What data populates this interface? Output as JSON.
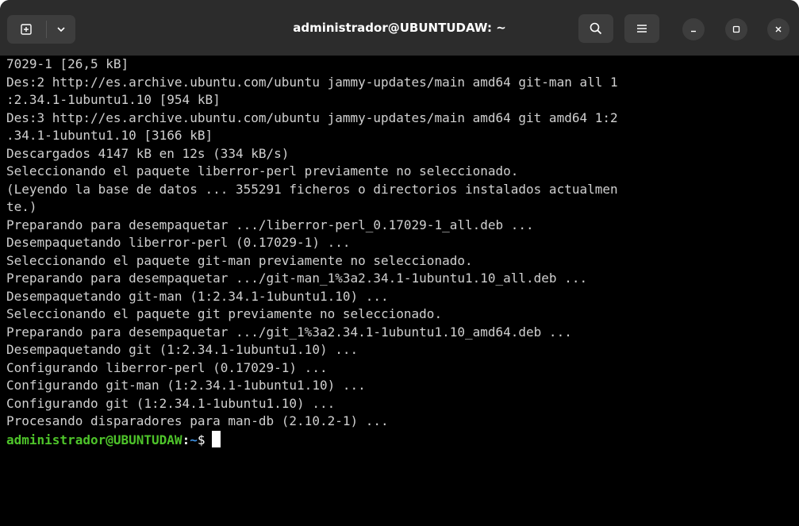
{
  "window": {
    "title": "administrador@UBUNTUDAW: ~",
    "colors": {
      "titlebar": "#2c2c2c",
      "button": "#3d3d3d",
      "terminal_bg": "#000000",
      "text": "#d0d0d0",
      "prompt_user": "#4ec42a",
      "prompt_path": "#3d8fe0"
    }
  },
  "header": {
    "new_tab_icon": "new-tab-icon",
    "dropdown_icon": "chevron-down-icon",
    "search_icon": "search-icon",
    "menu_icon": "hamburger-menu-icon",
    "minimize_icon": "minimize-icon",
    "maximize_icon": "maximize-icon",
    "close_icon": "close-icon"
  },
  "terminal": {
    "lines": [
      "7029-1 [26,5 kB]",
      "Des:2 http://es.archive.ubuntu.com/ubuntu jammy-updates/main amd64 git-man all 1",
      ":2.34.1-1ubuntu1.10 [954 kB]",
      "Des:3 http://es.archive.ubuntu.com/ubuntu jammy-updates/main amd64 git amd64 1:2",
      ".34.1-1ubuntu1.10 [3166 kB]",
      "Descargados 4147 kB en 12s (334 kB/s)",
      "Seleccionando el paquete liberror-perl previamente no seleccionado.",
      "(Leyendo la base de datos ... 355291 ficheros o directorios instalados actualmen",
      "te.)",
      "Preparando para desempaquetar .../liberror-perl_0.17029-1_all.deb ...",
      "Desempaquetando liberror-perl (0.17029-1) ...",
      "Seleccionando el paquete git-man previamente no seleccionado.",
      "Preparando para desempaquetar .../git-man_1%3a2.34.1-1ubuntu1.10_all.deb ...",
      "Desempaquetando git-man (1:2.34.1-1ubuntu1.10) ...",
      "Seleccionando el paquete git previamente no seleccionado.",
      "Preparando para desempaquetar .../git_1%3a2.34.1-1ubuntu1.10_amd64.deb ...",
      "Desempaquetando git (1:2.34.1-1ubuntu1.10) ...",
      "Configurando liberror-perl (0.17029-1) ...",
      "Configurando git-man (1:2.34.1-1ubuntu1.10) ...",
      "Configurando git (1:2.34.1-1ubuntu1.10) ...",
      "Procesando disparadores para man-db (2.10.2-1) ..."
    ],
    "prompt": {
      "user_host": "administrador@UBUNTUDAW",
      "colon": ":",
      "path": "~",
      "symbol": "$"
    }
  }
}
